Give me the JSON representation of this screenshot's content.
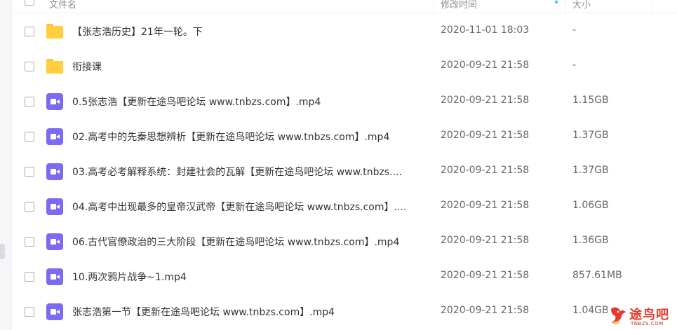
{
  "header": {
    "name_label": "文件名",
    "time_label": "修改时间",
    "sort_indicator": "↓",
    "size_label": "大小"
  },
  "files": [
    {
      "type": "folder",
      "icon": "folder-icon",
      "name": "【张志浩历史】21年一轮。下",
      "time": "2020-11-01 18:03",
      "size": "-"
    },
    {
      "type": "folder",
      "icon": "folder-icon",
      "name": "衔接课",
      "time": "2020-09-21 21:58",
      "size": "-"
    },
    {
      "type": "video",
      "icon": "video-icon",
      "name": "0.5张志浩【更新在途鸟吧论坛 www.tnbzs.com】.mp4",
      "time": "2020-09-21 21:58",
      "size": "1.15GB"
    },
    {
      "type": "video",
      "icon": "video-icon",
      "name": "02.高考中的先秦思想辨析【更新在途鸟吧论坛 www.tnbzs.com】.mp4",
      "time": "2020-09-21 21:58",
      "size": "1.37GB"
    },
    {
      "type": "video",
      "icon": "video-icon",
      "name": "03.高考必考解释系统：封建社会的瓦解【更新在途鸟吧论坛 www.tnbzs....",
      "time": "2020-09-21 21:58",
      "size": "1.37GB"
    },
    {
      "type": "video",
      "icon": "video-icon",
      "name": "04.高考中出现最多的皇帝汉武帝【更新在途鸟吧论坛 www.tnbzs.com】....",
      "time": "2020-09-21 21:58",
      "size": "1.06GB"
    },
    {
      "type": "video",
      "icon": "video-icon",
      "name": "06.古代官僚政治的三大阶段【更新在途鸟吧论坛 www.tnbzs.com】.mp4",
      "time": "2020-09-21 21:58",
      "size": "1.36GB"
    },
    {
      "type": "video",
      "icon": "video-icon",
      "name": "10.两次鸦片战争~1.mp4",
      "time": "2020-09-21 21:58",
      "size": "857.61MB"
    },
    {
      "type": "video",
      "icon": "video-icon",
      "name": "张志浩第一节【更新在途鸟吧论坛 www.tnbzs.com】.mp4",
      "time": "2020-09-21 21:58",
      "size": "1.04GB"
    }
  ],
  "watermark": {
    "text": "途鸟吧",
    "sub": "TNBZS.COM"
  },
  "colors": {
    "folder": "#ffcf3e",
    "video": "#7c6bf2",
    "accent": "#06a7ff",
    "watermark": "#e63a2e"
  }
}
